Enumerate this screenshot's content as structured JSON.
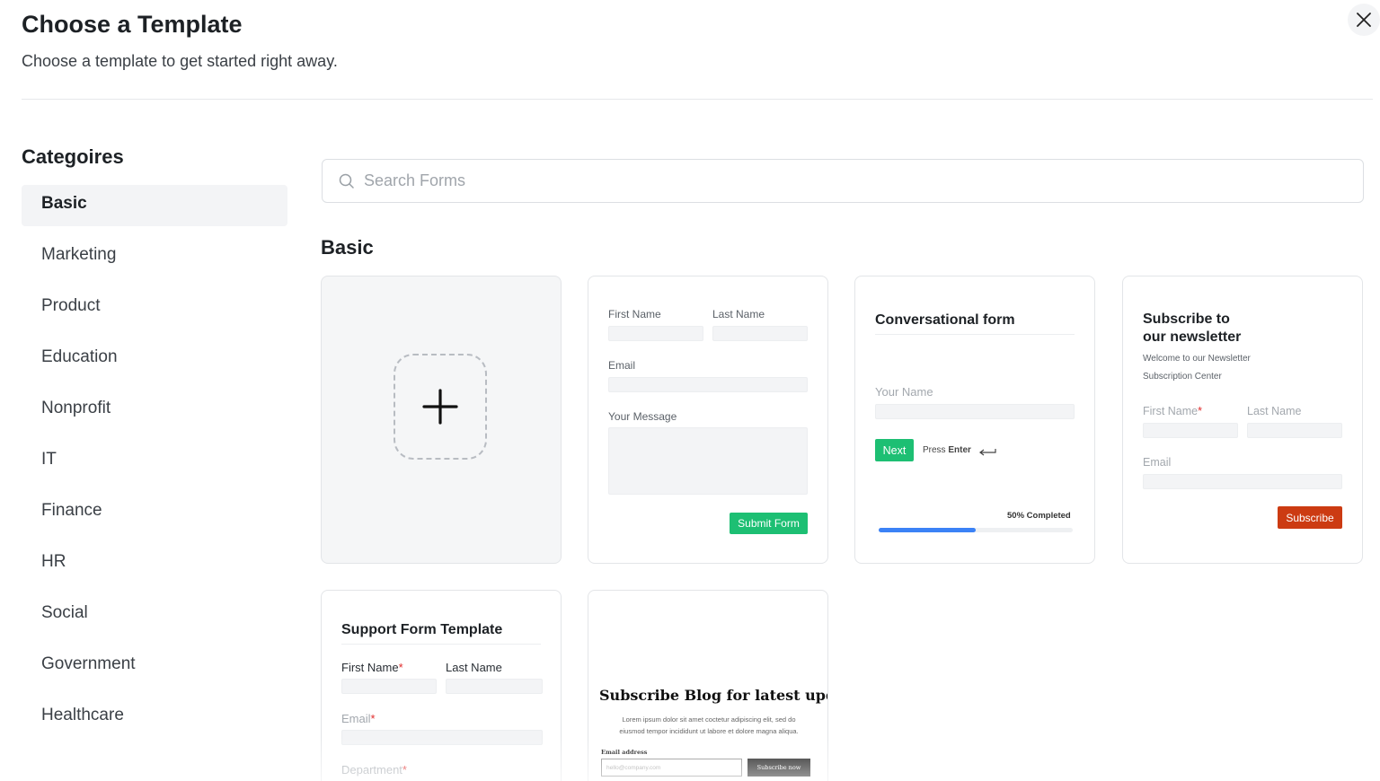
{
  "header": {
    "title": "Choose a Template",
    "subtitle": "Choose a template to get started right away."
  },
  "categories": {
    "heading": "Categoires",
    "items": [
      {
        "label": "Basic",
        "active": true
      },
      {
        "label": "Marketing"
      },
      {
        "label": "Product"
      },
      {
        "label": "Education"
      },
      {
        "label": "Nonprofit"
      },
      {
        "label": "IT"
      },
      {
        "label": "Finance"
      },
      {
        "label": "HR"
      },
      {
        "label": "Social"
      },
      {
        "label": "Government"
      },
      {
        "label": "Healthcare"
      }
    ]
  },
  "search": {
    "placeholder": "Search Forms",
    "value": ""
  },
  "section": {
    "title": "Basic"
  },
  "templates": {
    "contact": {
      "first_name": "First Name",
      "last_name": "Last Name",
      "email": "Email",
      "message": "Your Message",
      "submit": "Submit Form"
    },
    "conversational": {
      "title": "Conversational form",
      "your_name": "Your Name",
      "next": "Next",
      "press": "Press",
      "enter": "Enter",
      "progress_label": "50% Completed",
      "progress": 0.5
    },
    "newsletter": {
      "title_line1": "Subscribe to",
      "title_line2": "our newsletter",
      "welcome_line1": "Welcome to our Newsletter",
      "welcome_line2": "Subscription Center",
      "first_name": "First Name",
      "required_mark": "*",
      "last_name": "Last Name",
      "email": "Email",
      "subscribe": "Subscribe"
    },
    "support": {
      "title": "Support Form Template",
      "first_name": "First Name",
      "required_mark": "*",
      "last_name": "Last Name",
      "email": "Email",
      "department": "Department"
    },
    "blog": {
      "title": "Subscribe Blog for latest updates",
      "body_line1": "Lorem ipsum dolor sit amet coctetur adipiscing elit, sed do",
      "body_line2": "eiusmod tempor incididunt ut labore et dolore magna aliqua.",
      "email_label": "Email address",
      "email_placeholder": "hello@company.com",
      "button": "Subscribe now"
    }
  },
  "colors": {
    "accent_green": "#1dbf73",
    "progress_blue": "#3b82f6",
    "subscribe_red": "#cc3b12",
    "required_red": "#e02b2b"
  },
  "icons": {
    "close": "close-icon",
    "search": "search-icon",
    "plus": "plus-icon",
    "enter": "enter-key-icon"
  }
}
